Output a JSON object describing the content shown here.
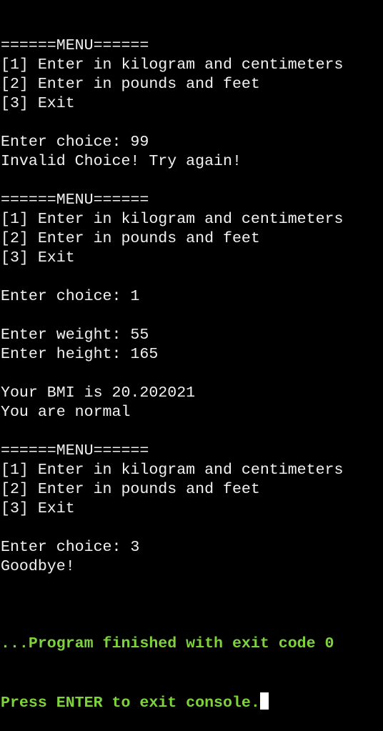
{
  "console": {
    "lines": [
      "======MENU======",
      "[1] Enter in kilogram and centimeters",
      "[2] Enter in pounds and feet",
      "[3] Exit",
      "",
      "Enter choice: 99",
      "Invalid Choice! Try again!",
      "",
      "======MENU======",
      "[1] Enter in kilogram and centimeters",
      "[2] Enter in pounds and feet",
      "[3] Exit",
      "",
      "Enter choice: 1",
      "",
      "Enter weight: 55",
      "Enter height: 165",
      "",
      "Your BMI is 20.202021",
      "You are normal",
      "",
      "======MENU======",
      "[1] Enter in kilogram and centimeters",
      "[2] Enter in pounds and feet",
      "[3] Exit",
      "",
      "Enter choice: 3",
      "Goodbye!",
      ""
    ],
    "status_line": "...Program finished with exit code 0",
    "prompt_line": "Press ENTER to exit console.",
    "status_color": "#7ed33c"
  }
}
